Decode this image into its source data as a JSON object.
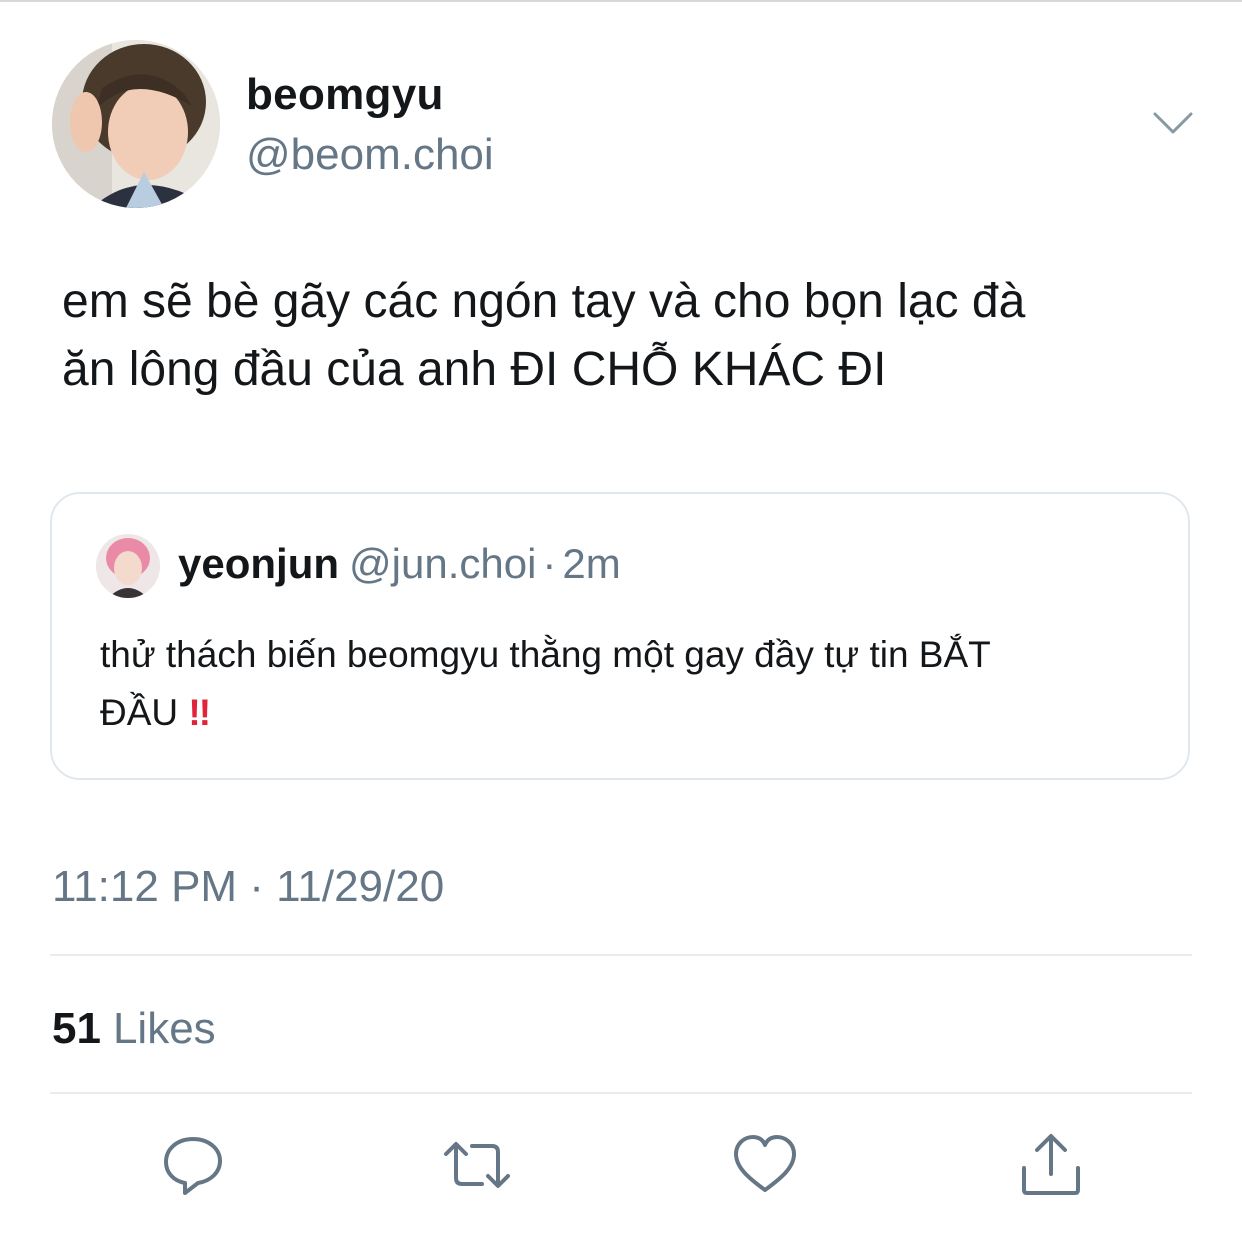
{
  "tweet": {
    "author": {
      "display_name": "beomgyu",
      "handle": "@beom.choi"
    },
    "text_line1": "em sẽ bè gãy các ngón tay và cho bọn lạc đà",
    "text_line2": "ăn lông đầu của anh ĐI CHỖ KHÁC ĐI",
    "quoted": {
      "display_name": "yeonjun",
      "handle": "@jun.choi",
      "separator": "·",
      "time": "2m",
      "text_line1": "thử thách biến beomgyu thằng một gay đầy tự tin BẮT",
      "text_line2": "ĐẦU",
      "emoji": "!!"
    },
    "timestamp": "11:12 PM · 11/29/20",
    "likes_count": "51",
    "likes_label": "Likes"
  },
  "icons": {
    "chevron": "chevron-down-icon",
    "reply": "reply-icon",
    "retweet": "retweet-icon",
    "like": "heart-icon",
    "share": "share-icon"
  },
  "colors": {
    "text": "#14171a",
    "secondary": "#657786",
    "border": "#e1e8ed",
    "icon": "#657786",
    "emoji_red": "#e0243a"
  }
}
